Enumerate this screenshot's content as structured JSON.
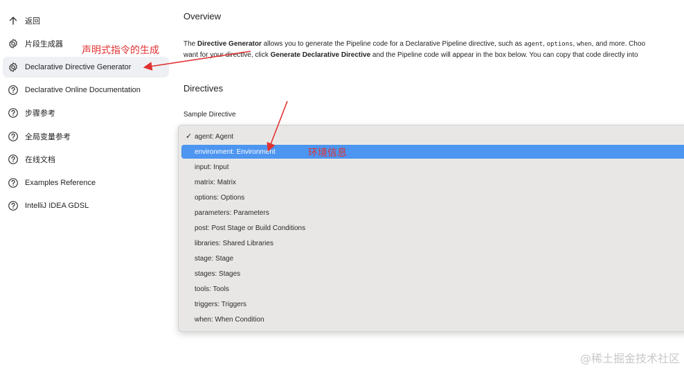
{
  "sidebar": {
    "items": [
      {
        "label": "返回",
        "icon": "arrow-up-icon"
      },
      {
        "label": "片段生成器",
        "icon": "gear-icon"
      },
      {
        "label": "Declarative Directive Generator",
        "icon": "gear-icon",
        "active": true
      },
      {
        "label": "Declarative Online Documentation",
        "icon": "help-circle-icon"
      },
      {
        "label": "步骤参考",
        "icon": "help-circle-icon"
      },
      {
        "label": "全局变量参考",
        "icon": "help-circle-icon"
      },
      {
        "label": "在线文档",
        "icon": "help-circle-icon"
      },
      {
        "label": "Examples Reference",
        "icon": "help-circle-icon"
      },
      {
        "label": "IntelliJ IDEA GDSL",
        "icon": "help-circle-icon"
      }
    ]
  },
  "main": {
    "overview_title": "Overview",
    "desc": {
      "p1": "The ",
      "b1": "Directive Generator",
      "p2": " allows you to generate the Pipeline code for a Declarative Pipeline directive, such as ",
      "c1": "agent",
      "p3": ", ",
      "c2": "options",
      "p4": ", ",
      "c3": "when",
      "p5": ", and more. Choo",
      "p6": "want for your directive, click ",
      "b2": "Generate Declarative Directive",
      "p7": " and the Pipeline code will appear in the box below. You can copy that code directly into"
    },
    "directives_title": "Directives",
    "sample_label": "Sample Directive",
    "dropdown": {
      "selected_index": 0,
      "highlighted_index": 1,
      "options": [
        "agent: Agent",
        "environment: Environment",
        "input: Input",
        "matrix: Matrix",
        "options: Options",
        "parameters: Parameters",
        "post: Post Stage or Build Conditions",
        "libraries: Shared Libraries",
        "stage: Stage",
        "stages: Stages",
        "tools: Tools",
        "triggers: Triggers",
        "when: When Condition"
      ]
    }
  },
  "annotations": {
    "a1": "声明式指令的生成",
    "a2": "环境信息",
    "color": "#e03131"
  },
  "watermark": "@稀土掘金技术社区"
}
